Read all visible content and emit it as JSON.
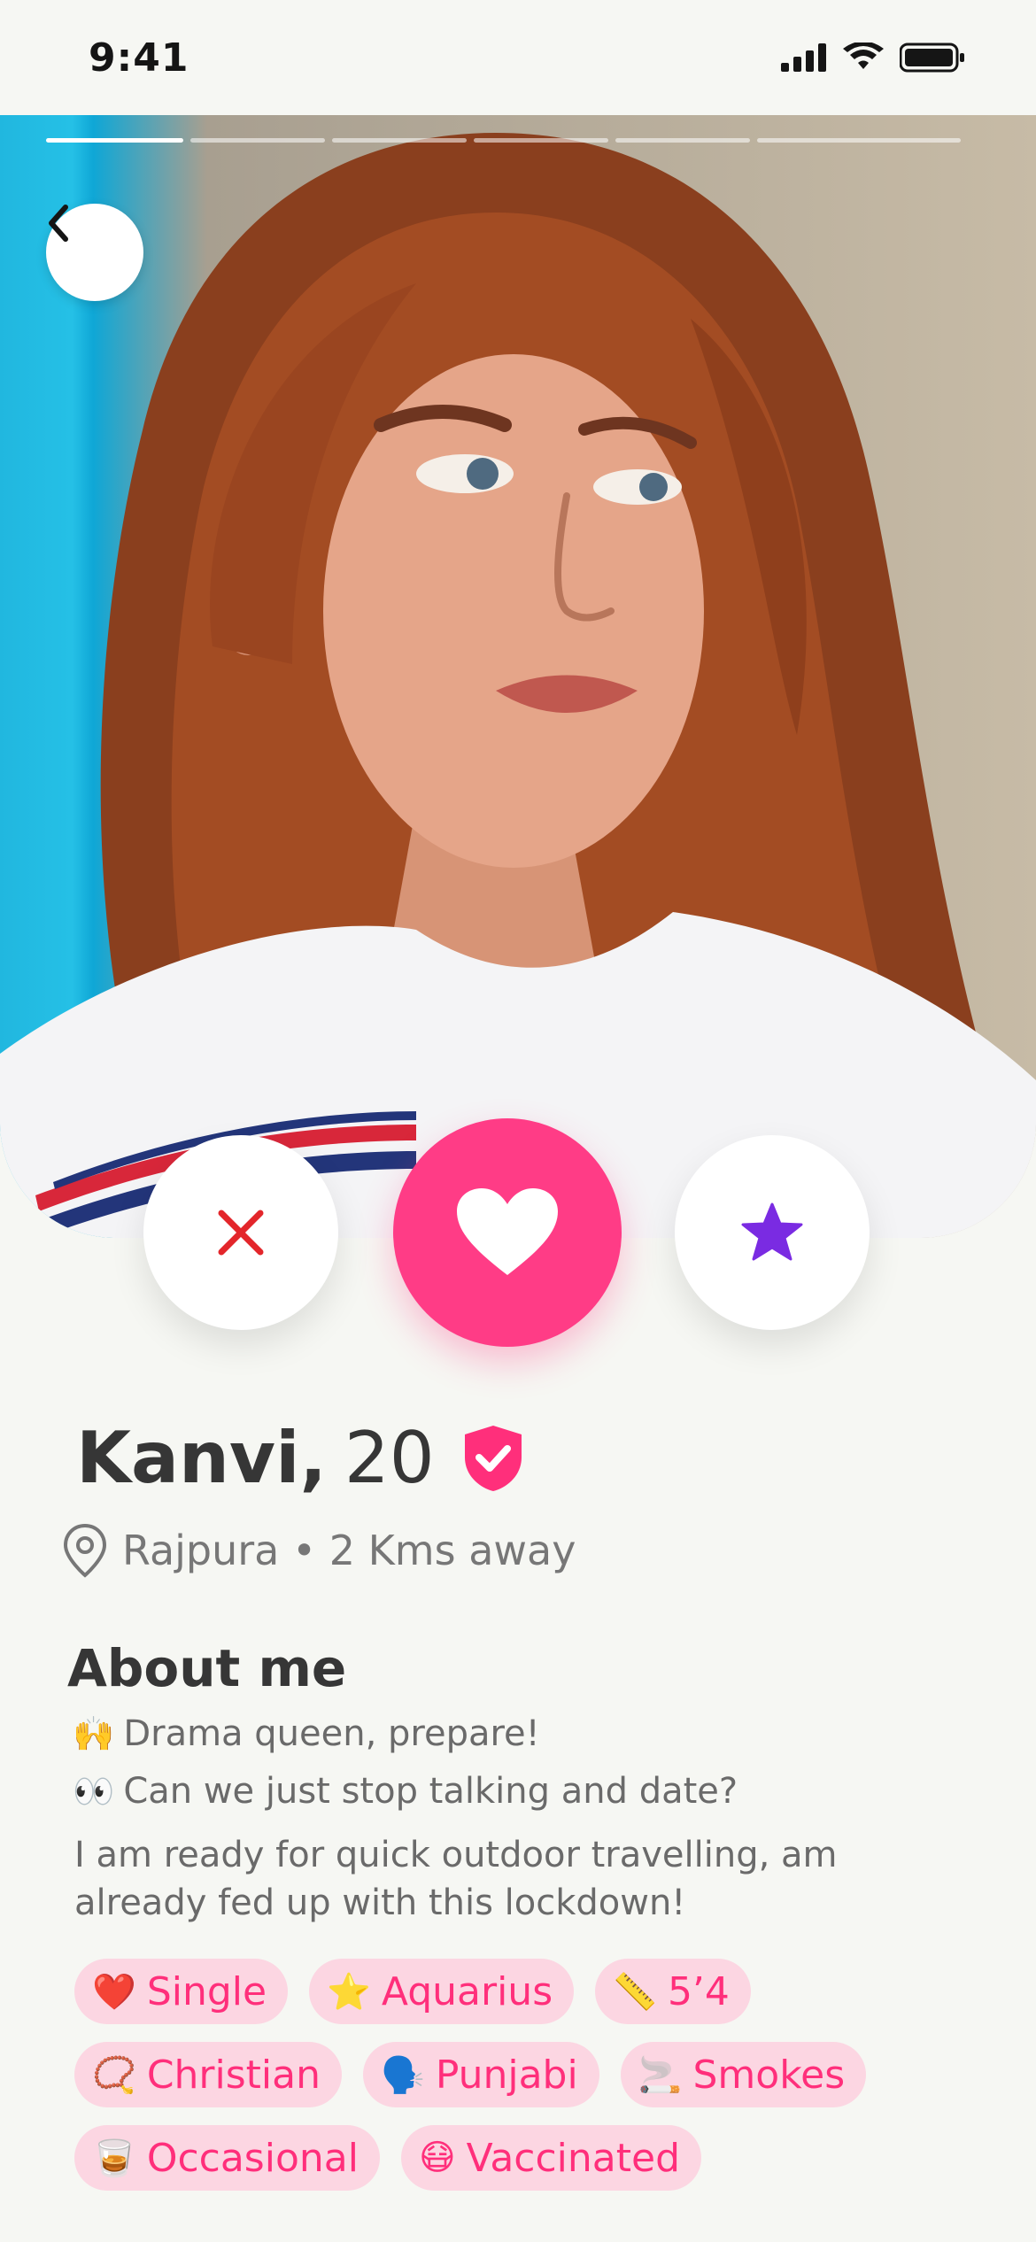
{
  "status_bar": {
    "time": "9:41"
  },
  "photo": {
    "progress_segments": 6,
    "active_segment": 1
  },
  "profile": {
    "name": "Kanvi,",
    "age": "20",
    "location": "Rajpura • 2 Kms away"
  },
  "about": {
    "title": "About me",
    "lines": [
      {
        "emoji": "🙌",
        "text": "Drama queen, prepare!"
      },
      {
        "emoji": "👀",
        "text": "Can we just stop talking and date?"
      }
    ],
    "paragraph": "I am ready for quick outdoor travelling, am already fed up with this lockdown!"
  },
  "tags": [
    {
      "icon": "❤️",
      "label": "Single"
    },
    {
      "icon": "⭐",
      "label": "Aquarius"
    },
    {
      "icon": "📏",
      "label": "5’4"
    },
    {
      "icon": "📿",
      "label": "Christian"
    },
    {
      "icon": "🗣️",
      "label": "Punjabi"
    },
    {
      "icon": "🚬",
      "label": "Smokes"
    },
    {
      "icon": "🥃",
      "label": "Occasional"
    },
    {
      "icon": "😷",
      "label": "Vaccinated"
    }
  ],
  "colors": {
    "accent": "#ff3c86",
    "tag_bg": "#fcd6e2",
    "tag_text": "#ff2f7b",
    "star": "#7a2be2",
    "dislike": "#e3262b"
  }
}
